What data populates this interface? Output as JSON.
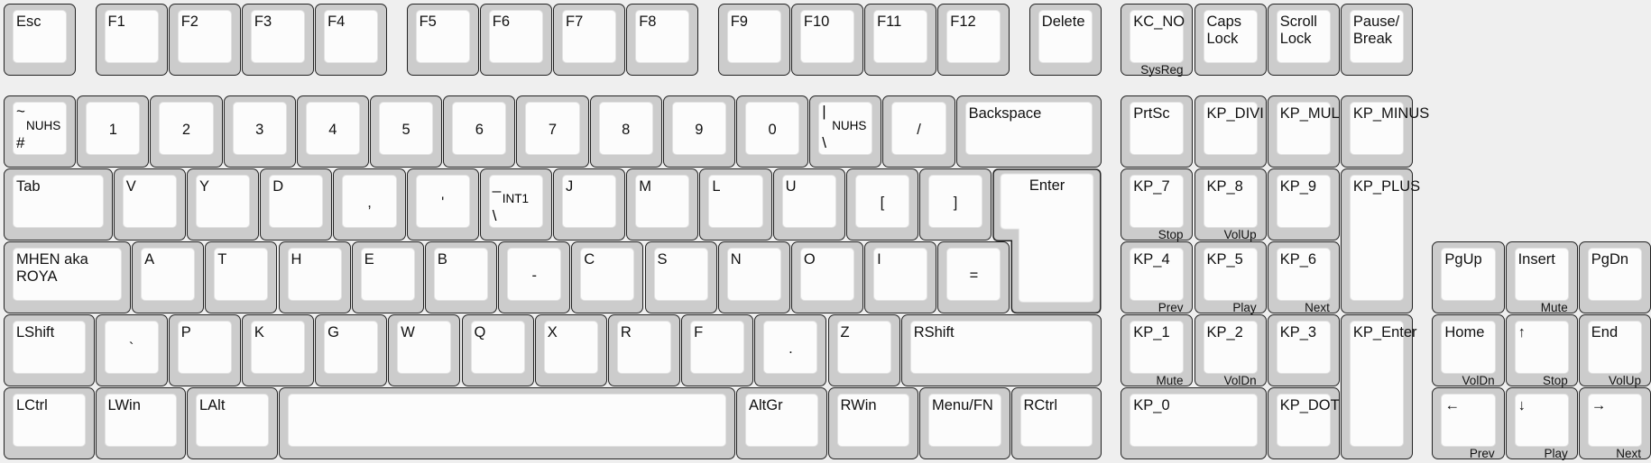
{
  "keyboard": {
    "keys": [
      {
        "label": "Esc"
      },
      {
        "label": "F1"
      },
      {
        "label": "F2"
      },
      {
        "label": "F3"
      },
      {
        "label": "F4"
      },
      {
        "label": "F5"
      },
      {
        "label": "F6"
      },
      {
        "label": "F7"
      },
      {
        "label": "F8"
      },
      {
        "label": "F9"
      },
      {
        "label": "F10"
      },
      {
        "label": "F11"
      },
      {
        "label": "F12"
      },
      {
        "label": "Delete"
      },
      {
        "label": "KC_NO",
        "sub": "SysReg"
      },
      {
        "label": "Caps\nLock"
      },
      {
        "label": "Scroll\nLock"
      },
      {
        "label": "Pause/\nBreak"
      },
      {
        "top": "~",
        "mid": "NUHS",
        "bottom": "#"
      },
      {
        "label": "1"
      },
      {
        "label": "2"
      },
      {
        "label": "3"
      },
      {
        "label": "4"
      },
      {
        "label": "5"
      },
      {
        "label": "6"
      },
      {
        "label": "7"
      },
      {
        "label": "8"
      },
      {
        "label": "9"
      },
      {
        "label": "0"
      },
      {
        "top": "|",
        "mid": "NUHS",
        "bottom": "\\"
      },
      {
        "label": "/"
      },
      {
        "label": "Backspace"
      },
      {
        "label": "PrtSc"
      },
      {
        "label": "KP_DIVI"
      },
      {
        "label": "KP_MUL"
      },
      {
        "label": "KP_MINUS"
      },
      {
        "label": "Tab"
      },
      {
        "label": "V"
      },
      {
        "label": "Y"
      },
      {
        "label": "D"
      },
      {
        "label": ","
      },
      {
        "label": "'"
      },
      {
        "top": "_",
        "mid": "INT1",
        "bottom": "\\"
      },
      {
        "label": "J"
      },
      {
        "label": "M"
      },
      {
        "label": "L"
      },
      {
        "label": "U"
      },
      {
        "label": "["
      },
      {
        "label": "]"
      },
      {
        "label": "Enter"
      },
      {
        "label": "KP_7",
        "sub": "Stop"
      },
      {
        "label": "KP_8",
        "sub": "VolUp"
      },
      {
        "label": "KP_9"
      },
      {
        "label": "KP_PLUS"
      },
      {
        "label": "MHEN aka\nROYA"
      },
      {
        "label": "A"
      },
      {
        "label": "T"
      },
      {
        "label": "H"
      },
      {
        "label": "E"
      },
      {
        "label": "B"
      },
      {
        "label": "-"
      },
      {
        "label": "C"
      },
      {
        "label": "S"
      },
      {
        "label": "N"
      },
      {
        "label": "O"
      },
      {
        "label": "I"
      },
      {
        "label": "="
      },
      {
        "label": "KP_4",
        "sub": "Prev"
      },
      {
        "label": "KP_5",
        "sub": "Play"
      },
      {
        "label": "KP_6",
        "sub": "Next"
      },
      {
        "label": "PgUp"
      },
      {
        "label": "Insert",
        "sub": "Mute"
      },
      {
        "label": "PgDn"
      },
      {
        "label": "LShift"
      },
      {
        "label": "`"
      },
      {
        "label": "P"
      },
      {
        "label": "K"
      },
      {
        "label": "G"
      },
      {
        "label": "W"
      },
      {
        "label": "Q"
      },
      {
        "label": "X"
      },
      {
        "label": "R"
      },
      {
        "label": "F"
      },
      {
        "label": "."
      },
      {
        "label": "Z"
      },
      {
        "label": "RShift"
      },
      {
        "label": "KP_1",
        "sub": "Mute"
      },
      {
        "label": "KP_2",
        "sub": "VolDn"
      },
      {
        "label": "KP_3"
      },
      {
        "label": "KP_Enter"
      },
      {
        "label": "Home",
        "sub": "VolDn"
      },
      {
        "label": "↑",
        "sub": "Stop"
      },
      {
        "label": "End",
        "sub": "VolUp"
      },
      {
        "label": "LCtrl"
      },
      {
        "label": "LWin"
      },
      {
        "label": "LAlt"
      },
      {
        "label": ""
      },
      {
        "label": "AltGr"
      },
      {
        "label": "RWin"
      },
      {
        "label": "Menu/FN"
      },
      {
        "label": "RCtrl"
      },
      {
        "label": "KP_0"
      },
      {
        "label": "KP_DOT"
      },
      {
        "label": "←",
        "sub": "Prev"
      },
      {
        "label": "↓",
        "sub": "Play"
      },
      {
        "label": "→",
        "sub": "Next"
      }
    ]
  },
  "colors": {
    "background": "#efefef",
    "key_border": "#cccccc",
    "key_cap": "#fcfcfc",
    "outline": "#222222"
  }
}
